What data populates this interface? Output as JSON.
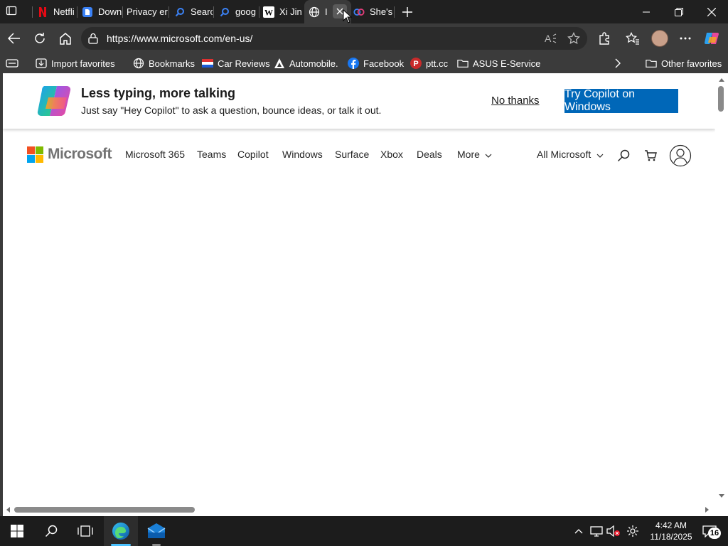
{
  "browser": {
    "tabs": [
      {
        "label": "",
        "icon": "tab-actions-icon"
      },
      {
        "label": "Netfli",
        "icon": "netflix-icon"
      },
      {
        "label": "Down",
        "icon": "doc-icon"
      },
      {
        "label": "Privacy err",
        "icon": "none"
      },
      {
        "label": "Searc",
        "icon": "search-icon"
      },
      {
        "label": "goog",
        "icon": "search-icon"
      },
      {
        "label": "Xi Jin",
        "icon": "wikipedia-icon"
      },
      {
        "label": "I",
        "icon": "globe-icon",
        "active": true
      },
      {
        "label": "She's",
        "icon": "copilot-icon"
      }
    ],
    "new_tab_icon": "plus-icon",
    "window_controls": [
      "minimize-icon",
      "restore-icon",
      "close-icon"
    ],
    "url": "https://www.microsoft.com/en-us/",
    "favorites": [
      {
        "label": "Import favorites",
        "icon": "import-icon"
      },
      {
        "label": "Bookmarks",
        "icon": "globe-icon"
      },
      {
        "label": "Car Reviews",
        "icon": "flag-icon"
      },
      {
        "label": "Automobile.",
        "icon": "automobile-icon"
      },
      {
        "label": "Facebook",
        "icon": "facebook-icon"
      },
      {
        "label": "ptt.cc",
        "icon": "ptt-icon"
      },
      {
        "label": "ASUS E-Service",
        "icon": "folder-icon"
      }
    ],
    "other_favorites": "Other favorites"
  },
  "banner": {
    "title": "Less typing, more talking",
    "subtitle": "Just say \"Hey Copilot\" to ask a question, bounce ideas, or talk it out.",
    "no_thanks": "No thanks",
    "cta": "Try Copilot on Windows"
  },
  "header": {
    "logo_text": "Microsoft",
    "nav": [
      "Microsoft 365",
      "Teams",
      "Copilot",
      "Windows",
      "Surface",
      "Xbox",
      "Deals",
      "More"
    ],
    "all_microsoft": "All Microsoft"
  },
  "taskbar": {
    "time": "4:42 AM",
    "date": "11/18/2025",
    "notifications": "16"
  },
  "colors": {
    "chrome_dark": "#202020",
    "toolbar": "#3b3b3b",
    "ms_blue": "#0067b8",
    "taskbar": "#1c1c1c"
  }
}
